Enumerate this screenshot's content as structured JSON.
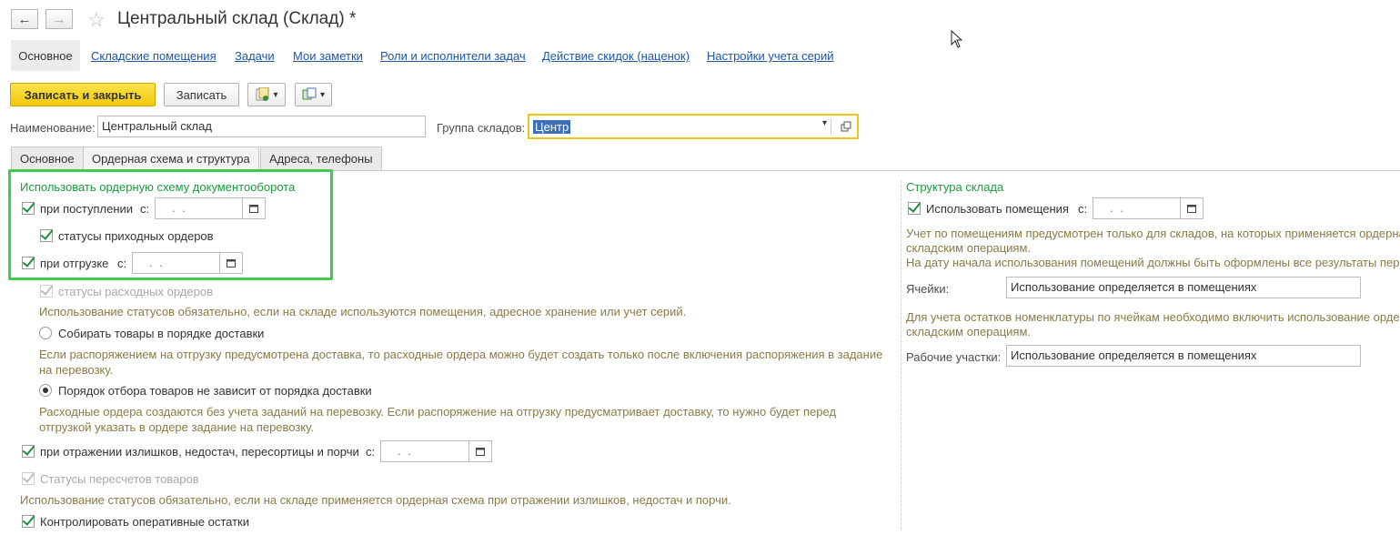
{
  "window": {
    "title": "Центральный склад (Склад) *"
  },
  "nav": {
    "back_icon": "←",
    "forward_icon": "→",
    "favorite_icon": "☆"
  },
  "top_links": [
    {
      "label": "Основное"
    },
    {
      "label": "Складские помещения"
    },
    {
      "label": "Задачи"
    },
    {
      "label": "Мои заметки"
    },
    {
      "label": "Роли и исполнители задач"
    },
    {
      "label": "Действие скидок (наценок)"
    },
    {
      "label": "Настройки учета серий"
    }
  ],
  "toolbar": {
    "save_close_label": "Записать и закрыть",
    "save_label": "Записать",
    "dropdown_arrow": "▾"
  },
  "form": {
    "name_label": "Наименование:",
    "name_value": "Центральный склад",
    "group_label": "Группа складов:",
    "group_value": "Центр"
  },
  "tabs": [
    {
      "label": "Основное"
    },
    {
      "label": "Ордерная схема и структура"
    },
    {
      "label": "Адреса, телефоны"
    }
  ],
  "left": {
    "section_title": "Использовать ордерную схему документооборота",
    "receipt_label": "при поступлении",
    "from_label": "с:",
    "date_placeholder": ". .",
    "receipt_statuses_label": "статусы приходных ордеров",
    "shipment_label": "при отгрузке",
    "shipment_statuses_label": "статусы расходных ордеров",
    "statuses_note": "Использование статусов обязательно, если на складе используются помещения, адресное хранение или учет серий.",
    "collect_delivery_label": "Собирать товары в порядке доставки",
    "collect_delivery_note_1": "Если распоряжением на отгрузку предусмотрена доставка, то расходные ордера можно будет создать только после включения распоряжения в задание",
    "collect_delivery_note_2": "на перевозку.",
    "independent_order_label": "Порядок отбора товаров не зависит от порядка доставки",
    "independent_note_1": "Расходные ордера создаются без учета заданий на перевозку. Если распоряжение на отгрузку предусматривает доставку, то нужно будет перед",
    "independent_note_2": "отгрузкой указать в ордере задание на перевозку.",
    "surplus_label": "при отражении излишков, недостач, пересортицы и порчи",
    "recount_statuses_label": "Статусы пересчетов товаров",
    "recount_note": "Использование статусов обязательно, если на складе применяется ордерная схема при отражении излишков, недостач и порчи.",
    "control_stock_label": "Контролировать оперативные остатки"
  },
  "right": {
    "section_title": "Структура склада",
    "use_rooms_label": "Использовать помещения",
    "from_label": "с:",
    "date_placeholder": ". .",
    "rooms_note_1": "Учет по помещениям предусмотрен только для складов, на которых применяется ордерна",
    "rooms_note_2": "складским операциям.",
    "rooms_note_3": "На дату начала использования помещений должны быть оформлены все результаты перес",
    "cells_label": "Ячейки:",
    "cells_value": "Использование определяется в помещениях",
    "cells_note_1": "Для учета остатков номенклатуры по ячейкам необходимо включить использование ордер",
    "cells_note_2": "складским операциям.",
    "work_areas_label": "Рабочие участки:",
    "work_areas_value": "Использование определяется в помещениях"
  },
  "colors": {
    "section_green": "#1b9b3b",
    "link_blue": "#1e57a3",
    "primary_yellow": "#f4cd1a",
    "highlight_frame": "#41c94b",
    "note_brown": "#8a7a45"
  }
}
